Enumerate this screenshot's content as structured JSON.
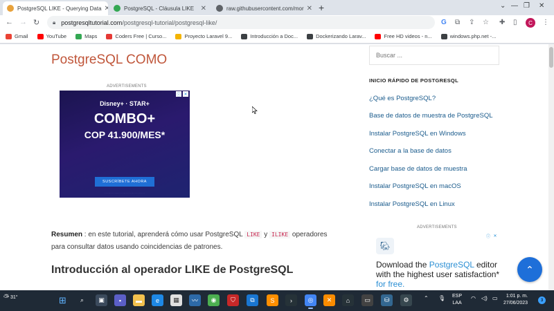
{
  "browser": {
    "tabs": [
      {
        "title": "PostgreSQL LIKE - Querying Data",
        "active": true,
        "color": "#e8a23c"
      },
      {
        "title": "PostgreSQL - Cláusula LIKE",
        "active": false,
        "color": "#34a853"
      },
      {
        "title": "raw.githubusercontent.com/mor",
        "active": false,
        "color": "#5f6368"
      }
    ],
    "url_domain": "postgresqltutorial.com",
    "url_path": "/postgresql-tutorial/postgresql-like/",
    "avatar_letter": "C",
    "bookmarks": [
      {
        "label": "Gmail",
        "color": "#ea4335"
      },
      {
        "label": "YouTube",
        "color": "#ff0000"
      },
      {
        "label": "Maps",
        "color": "#34a853"
      },
      {
        "label": "Coders Free | Curso...",
        "color": "#e53935"
      },
      {
        "label": "Proyecto Laravel 9...",
        "color": "#f4b400"
      },
      {
        "label": "Introducción a Doc...",
        "color": "#3c4043"
      },
      {
        "label": "Dockerizando Larav...",
        "color": "#3c4043"
      },
      {
        "label": "Free HD videos - n...",
        "color": "#ff0000"
      },
      {
        "label": "windows.php.net -...",
        "color": "#3c4043"
      }
    ]
  },
  "page": {
    "title": "PostgreSQL COMO",
    "ad_label": "ADVERTISEMENTS",
    "ad1": {
      "brand": "Disney+ · STAR+",
      "headline": "COMBO+",
      "price": "COP 41.900/MES*",
      "cta": "SUSCRÍBETE AHORA"
    },
    "summary_label": "Resumen",
    "summary_part1": " : en este tutorial, aprenderá cómo usar PostgreSQL ",
    "code_like": "LIKE",
    "summary_y": " y ",
    "code_ilike": "ILIKE",
    "summary_part2": " operadores para consultar datos usando coincidencias de patrones.",
    "section_heading": "Introducción al operador LIKE de PostgreSQL"
  },
  "sidebar": {
    "search_placeholder": "Buscar ...",
    "heading": "INICIO RÁPIDO DE POSTGRESQL",
    "links": [
      "¿Qué es PostgreSQL?",
      "Base de datos de muestra de PostgreSQL",
      "Instalar PostgreSQL en Windows",
      "Conectar a la base de datos",
      "Cargar base de datos de muestra",
      "Instalar PostgreSQL en macOS",
      "Instalar PostgreSQL en Linux"
    ],
    "ad_label": "ADVERTISEMENTS",
    "ad2": {
      "text1": "Download the ",
      "highlight1": "PostgreSQL",
      "text2": " editor with the highest user satisfaction* ",
      "highlight2": "for free."
    }
  },
  "taskbar": {
    "temperature": "31°",
    "lang1": "ESP",
    "lang2": "LAA",
    "time": "1:01 p. m.",
    "date": "27/06/2023",
    "notifications": "3"
  }
}
